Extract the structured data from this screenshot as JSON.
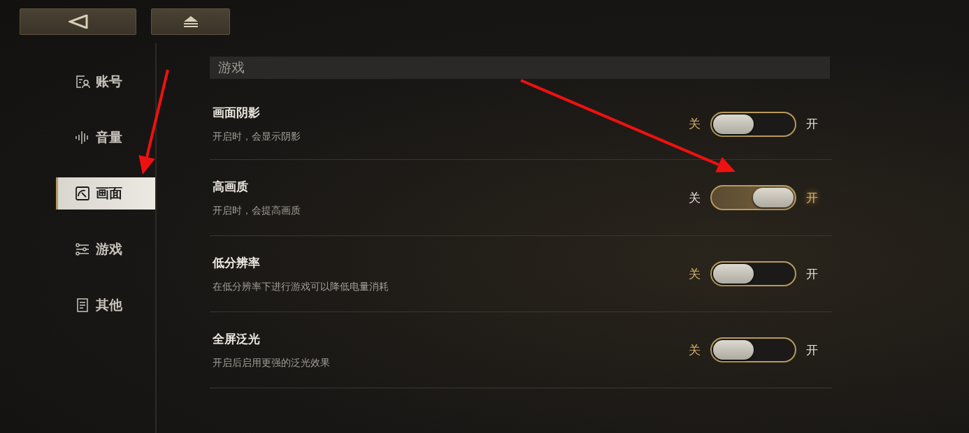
{
  "top_buttons": [
    {
      "kind": "back"
    },
    {
      "kind": "eject"
    }
  ],
  "sidebar": {
    "items": [
      {
        "label": "账号",
        "kind": "account",
        "selected": false
      },
      {
        "label": "音量",
        "kind": "volume",
        "selected": false
      },
      {
        "label": "画面",
        "kind": "graphics",
        "selected": true
      },
      {
        "label": "游戏",
        "kind": "game",
        "selected": false
      },
      {
        "label": "其他",
        "kind": "other",
        "selected": false
      }
    ]
  },
  "section": {
    "title": "游戏"
  },
  "settings": [
    {
      "title": "画面阴影",
      "description": "开启时，会显示阴影",
      "off_label": "关",
      "on_label": "开",
      "on": false
    },
    {
      "title": "高画质",
      "description": "开启时，会提高画质",
      "off_label": "关",
      "on_label": "开",
      "on": true
    },
    {
      "title": "低分辨率",
      "description": "在低分辨率下进行游戏可以降低电量消耗",
      "off_label": "关",
      "on_label": "开",
      "on": false
    },
    {
      "title": "全屏泛光",
      "description": "开启后启用更强的泛光效果",
      "off_label": "关",
      "on_label": "开",
      "on": false
    }
  ],
  "annotations": [
    {
      "kind": "arrow"
    },
    {
      "kind": "arrow"
    }
  ]
}
